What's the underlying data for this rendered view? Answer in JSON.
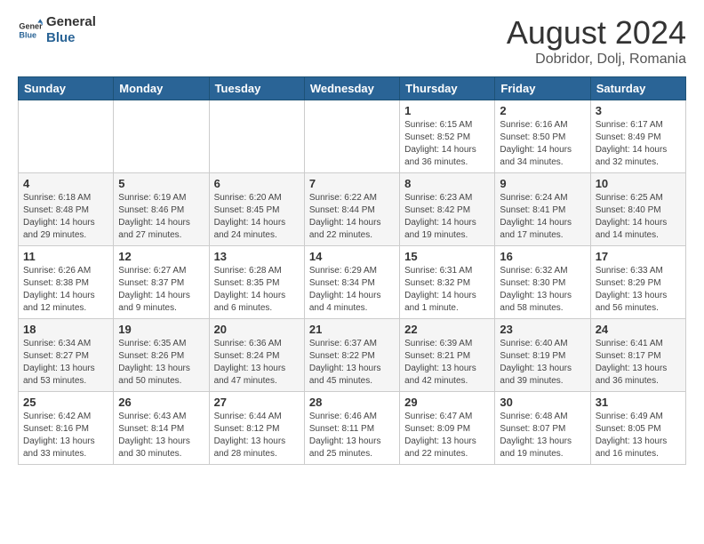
{
  "logo": {
    "line1": "General",
    "line2": "Blue"
  },
  "title": {
    "month_year": "August 2024",
    "location": "Dobridor, Dolj, Romania"
  },
  "days_of_week": [
    "Sunday",
    "Monday",
    "Tuesday",
    "Wednesday",
    "Thursday",
    "Friday",
    "Saturday"
  ],
  "weeks": [
    [
      {
        "day": "",
        "info": ""
      },
      {
        "day": "",
        "info": ""
      },
      {
        "day": "",
        "info": ""
      },
      {
        "day": "",
        "info": ""
      },
      {
        "day": "1",
        "info": "Sunrise: 6:15 AM\nSunset: 8:52 PM\nDaylight: 14 hours and 36 minutes."
      },
      {
        "day": "2",
        "info": "Sunrise: 6:16 AM\nSunset: 8:50 PM\nDaylight: 14 hours and 34 minutes."
      },
      {
        "day": "3",
        "info": "Sunrise: 6:17 AM\nSunset: 8:49 PM\nDaylight: 14 hours and 32 minutes."
      }
    ],
    [
      {
        "day": "4",
        "info": "Sunrise: 6:18 AM\nSunset: 8:48 PM\nDaylight: 14 hours and 29 minutes."
      },
      {
        "day": "5",
        "info": "Sunrise: 6:19 AM\nSunset: 8:46 PM\nDaylight: 14 hours and 27 minutes."
      },
      {
        "day": "6",
        "info": "Sunrise: 6:20 AM\nSunset: 8:45 PM\nDaylight: 14 hours and 24 minutes."
      },
      {
        "day": "7",
        "info": "Sunrise: 6:22 AM\nSunset: 8:44 PM\nDaylight: 14 hours and 22 minutes."
      },
      {
        "day": "8",
        "info": "Sunrise: 6:23 AM\nSunset: 8:42 PM\nDaylight: 14 hours and 19 minutes."
      },
      {
        "day": "9",
        "info": "Sunrise: 6:24 AM\nSunset: 8:41 PM\nDaylight: 14 hours and 17 minutes."
      },
      {
        "day": "10",
        "info": "Sunrise: 6:25 AM\nSunset: 8:40 PM\nDaylight: 14 hours and 14 minutes."
      }
    ],
    [
      {
        "day": "11",
        "info": "Sunrise: 6:26 AM\nSunset: 8:38 PM\nDaylight: 14 hours and 12 minutes."
      },
      {
        "day": "12",
        "info": "Sunrise: 6:27 AM\nSunset: 8:37 PM\nDaylight: 14 hours and 9 minutes."
      },
      {
        "day": "13",
        "info": "Sunrise: 6:28 AM\nSunset: 8:35 PM\nDaylight: 14 hours and 6 minutes."
      },
      {
        "day": "14",
        "info": "Sunrise: 6:29 AM\nSunset: 8:34 PM\nDaylight: 14 hours and 4 minutes."
      },
      {
        "day": "15",
        "info": "Sunrise: 6:31 AM\nSunset: 8:32 PM\nDaylight: 14 hours and 1 minute."
      },
      {
        "day": "16",
        "info": "Sunrise: 6:32 AM\nSunset: 8:30 PM\nDaylight: 13 hours and 58 minutes."
      },
      {
        "day": "17",
        "info": "Sunrise: 6:33 AM\nSunset: 8:29 PM\nDaylight: 13 hours and 56 minutes."
      }
    ],
    [
      {
        "day": "18",
        "info": "Sunrise: 6:34 AM\nSunset: 8:27 PM\nDaylight: 13 hours and 53 minutes."
      },
      {
        "day": "19",
        "info": "Sunrise: 6:35 AM\nSunset: 8:26 PM\nDaylight: 13 hours and 50 minutes."
      },
      {
        "day": "20",
        "info": "Sunrise: 6:36 AM\nSunset: 8:24 PM\nDaylight: 13 hours and 47 minutes."
      },
      {
        "day": "21",
        "info": "Sunrise: 6:37 AM\nSunset: 8:22 PM\nDaylight: 13 hours and 45 minutes."
      },
      {
        "day": "22",
        "info": "Sunrise: 6:39 AM\nSunset: 8:21 PM\nDaylight: 13 hours and 42 minutes."
      },
      {
        "day": "23",
        "info": "Sunrise: 6:40 AM\nSunset: 8:19 PM\nDaylight: 13 hours and 39 minutes."
      },
      {
        "day": "24",
        "info": "Sunrise: 6:41 AM\nSunset: 8:17 PM\nDaylight: 13 hours and 36 minutes."
      }
    ],
    [
      {
        "day": "25",
        "info": "Sunrise: 6:42 AM\nSunset: 8:16 PM\nDaylight: 13 hours and 33 minutes."
      },
      {
        "day": "26",
        "info": "Sunrise: 6:43 AM\nSunset: 8:14 PM\nDaylight: 13 hours and 30 minutes."
      },
      {
        "day": "27",
        "info": "Sunrise: 6:44 AM\nSunset: 8:12 PM\nDaylight: 13 hours and 28 minutes."
      },
      {
        "day": "28",
        "info": "Sunrise: 6:46 AM\nSunset: 8:11 PM\nDaylight: 13 hours and 25 minutes."
      },
      {
        "day": "29",
        "info": "Sunrise: 6:47 AM\nSunset: 8:09 PM\nDaylight: 13 hours and 22 minutes."
      },
      {
        "day": "30",
        "info": "Sunrise: 6:48 AM\nSunset: 8:07 PM\nDaylight: 13 hours and 19 minutes."
      },
      {
        "day": "31",
        "info": "Sunrise: 6:49 AM\nSunset: 8:05 PM\nDaylight: 13 hours and 16 minutes."
      }
    ]
  ]
}
